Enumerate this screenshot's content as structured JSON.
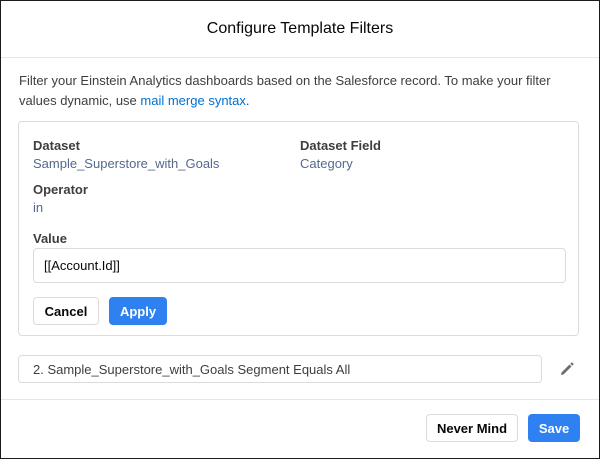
{
  "modal": {
    "title": "Configure Template Filters",
    "intro_text": "Filter your Einstein Analytics dashboards based on the Salesforce record. To make your filter values dynamic, use ",
    "intro_link": "mail merge syntax",
    "intro_end": "."
  },
  "filter": {
    "dataset_label": "Dataset",
    "dataset_value": "Sample_Superstore_with_Goals",
    "field_label": "Dataset Field",
    "field_value": "Category",
    "operator_label": "Operator",
    "operator_value": "in",
    "value_label": "Value",
    "value_input": "[[Account.Id]]",
    "cancel_label": "Cancel",
    "apply_label": "Apply"
  },
  "filter_list": [
    {
      "text": "2. Sample_Superstore_with_Goals Segment Equals All"
    }
  ],
  "footer": {
    "never_mind_label": "Never Mind",
    "save_label": "Save"
  },
  "colors": {
    "brand": "#2f80f0",
    "link": "#0070d2"
  },
  "icons": {
    "edit": "pencil-icon"
  }
}
